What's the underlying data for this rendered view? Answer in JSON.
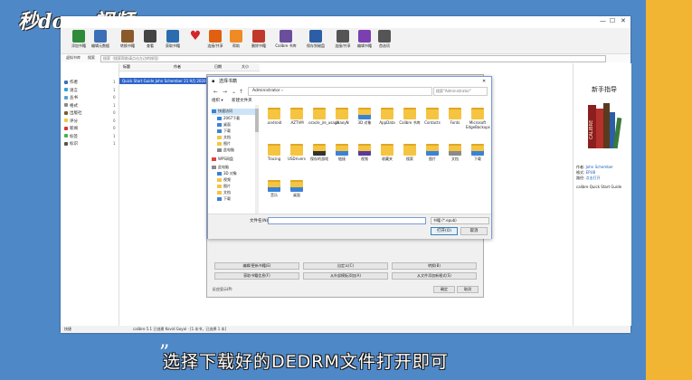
{
  "logo": "秒dong视频",
  "window": {
    "toolbar": [
      {
        "label": "添加书籍",
        "icon": "add-book-icon",
        "color": "#2e8b3a"
      },
      {
        "label": "编辑元数据",
        "icon": "edit-metadata-icon",
        "color": "#3b6fb6"
      },
      {
        "label": "转换书籍",
        "icon": "convert-book-icon",
        "color": "#8b5a2b"
      },
      {
        "label": "查看",
        "icon": "view-icon",
        "color": "#444"
      },
      {
        "label": "获取书籍",
        "icon": "fetch-news-icon",
        "color": "#2b6cb0"
      },
      {
        "label": "",
        "icon": "heart-icon",
        "color": "#d3262a"
      },
      {
        "label": "连接/共享",
        "icon": "connect-share-icon",
        "color": "#e06010"
      },
      {
        "label": "帮助",
        "icon": "help-icon",
        "color": "#f08a24"
      },
      {
        "label": "删除书籍",
        "icon": "remove-book-icon",
        "color": "#c0392b"
      },
      {
        "label": "Calibre 书库",
        "icon": "library-icon",
        "color": "#6b4e9b"
      },
      {
        "label": "保存到磁盘",
        "icon": "save-icon",
        "color": "#2b5ea7"
      },
      {
        "label": "连接/共享",
        "icon": "network-icon",
        "color": "#555"
      },
      {
        "label": "编辑书籍",
        "icon": "edit-book-icon",
        "color": "#7b3fb0"
      },
      {
        "label": "首选项",
        "icon": "preferences-icon",
        "color": "#555"
      }
    ],
    "search_label": "搜索",
    "search_placeholder": "搜索（搜索帮助请点击左边的按钮）",
    "sidebar_header": "虚拟书库",
    "sidebar": [
      {
        "label": "作者",
        "color": "#3b6fb6",
        "count": "1"
      },
      {
        "label": "语言",
        "color": "#3b9bd6",
        "count": "1"
      },
      {
        "label": "丛书",
        "color": "#5aa0d0",
        "count": "0"
      },
      {
        "label": "格式",
        "color": "#8a8a8a",
        "count": "1"
      },
      {
        "label": "出版社",
        "color": "#7a5c2e",
        "count": "0"
      },
      {
        "label": "评分",
        "color": "#f5c542",
        "count": "0"
      },
      {
        "label": "新闻",
        "color": "#d33",
        "count": "0"
      },
      {
        "label": "标签",
        "color": "#4caf50",
        "count": "1"
      },
      {
        "label": "标识",
        "color": "#555",
        "count": "1"
      }
    ],
    "book_columns": [
      "标题",
      "作者",
      "日期",
      "大小"
    ],
    "book_row": "Quick Start Guide  John Schember  21 9月 2020  0.1",
    "right_panel": {
      "title": "新手指导",
      "author_label": "作者:",
      "author": "John Schember",
      "formats_label": "格式:",
      "formats": "EPUB",
      "path_label": "路径:",
      "path": "点击打开",
      "summary": "calibre Quick Start Guide"
    },
    "status_left": "快捷",
    "status_text": "calibre 5.1 已创建 Kovid Goyal · [1 本书，已选择 1 本]"
  },
  "convert_dialog": {
    "btn_row1": [
      "编辑/更新书籍(E)",
      "自定义(C)",
      "转换(B)"
    ],
    "btn_row2": [
      "获取书籍信息(F)",
      "从外部模板添加(A)",
      "从文件添加新格式(S)"
    ],
    "bottom_left": "反应显示(P)",
    "ok": "确定",
    "cancel": "取消"
  },
  "open_dialog": {
    "title": "选择书籍",
    "path": "Administrator",
    "search_placeholder": "搜索\"Administrator\"",
    "organize": "组织 ▾",
    "new_folder": "新建文件夹",
    "tree": [
      {
        "label": "快速访问"
      },
      {
        "label": "2067下载"
      },
      {
        "label": "桌面"
      },
      {
        "label": "下载"
      },
      {
        "label": "文档"
      },
      {
        "label": "图片"
      },
      {
        "label": "此电脑"
      },
      {
        "label": "WPS网盘"
      },
      {
        "label": "此电脑"
      },
      {
        "label": "3D 对象"
      },
      {
        "label": "视频"
      },
      {
        "label": "图片"
      },
      {
        "label": "文档"
      },
      {
        "label": "下载"
      }
    ],
    "files": [
      {
        "label": ".android"
      },
      {
        "label": ".AZTVM"
      },
      {
        "label": ".oracle_jre_usage"
      },
      {
        "label": ".XiaoyN"
      },
      {
        "label": "3D 对象"
      },
      {
        "label": "AppData"
      },
      {
        "label": "Calibre 书库"
      },
      {
        "label": "Contacts"
      },
      {
        "label": "Fonts"
      },
      {
        "label": "Microsoft EdgeBackups"
      },
      {
        "label": "Tracing"
      },
      {
        "label": "USDrivers"
      },
      {
        "label": "保存的游戏"
      },
      {
        "label": "链接"
      },
      {
        "label": "视频"
      },
      {
        "label": "收藏夹"
      },
      {
        "label": "搜索"
      },
      {
        "label": "图片"
      },
      {
        "label": "文档"
      },
      {
        "label": "下载"
      },
      {
        "label": "音乐"
      },
      {
        "label": "桌面"
      }
    ],
    "filename_label": "文件名(N):",
    "filename_value": "",
    "filetype": "书籍 (*.epub)",
    "open": "打开(O)",
    "cancel": "取消"
  },
  "subtitle": "选择下载好的DEDRM文件打开即可"
}
